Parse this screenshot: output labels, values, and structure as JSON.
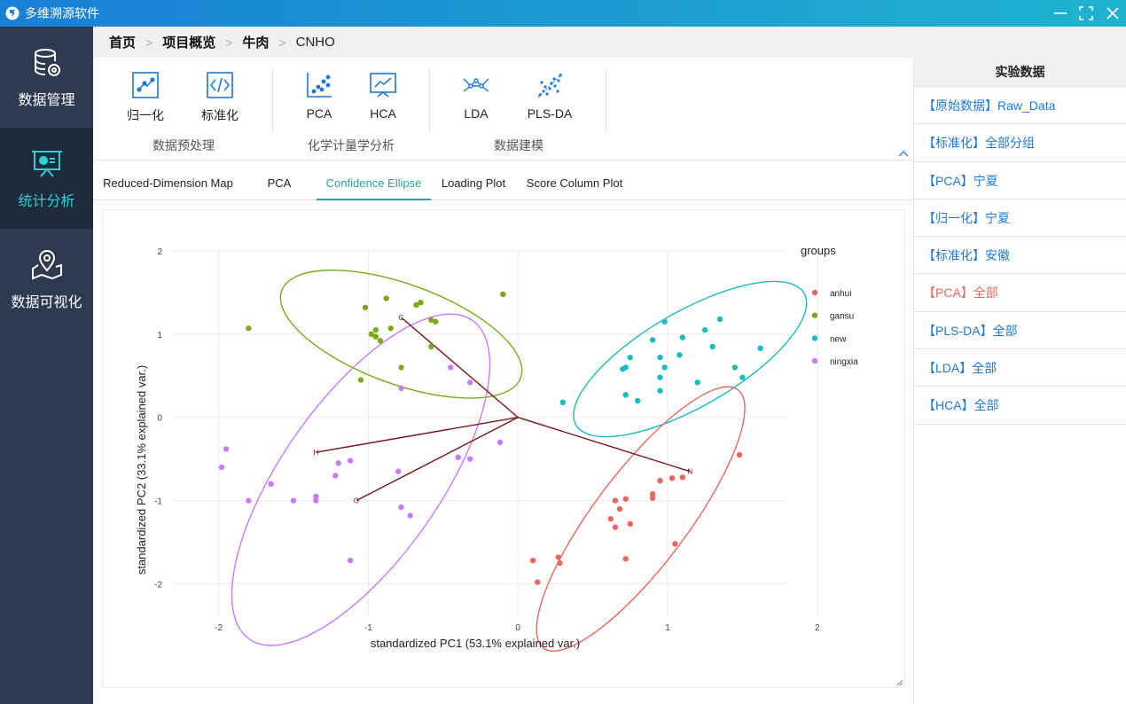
{
  "app": {
    "title": "多维溯源软件"
  },
  "sidebar": {
    "items": [
      {
        "label": "数据管理",
        "icon": "database-gear-icon",
        "active": false
      },
      {
        "label": "统计分析",
        "icon": "presentation-chart-icon",
        "active": true
      },
      {
        "label": "数据可视化",
        "icon": "map-pin-icon",
        "active": false
      }
    ]
  },
  "breadcrumb": [
    "首页",
    "项目概览",
    "牛肉",
    "CNHO"
  ],
  "toolbar": {
    "groups": [
      {
        "label": "数据预处理",
        "tools": [
          {
            "label": "归一化",
            "icon": "normalize-icon"
          },
          {
            "label": "标准化",
            "icon": "code-icon"
          }
        ]
      },
      {
        "label": "化学计量学分析",
        "tools": [
          {
            "label": "PCA",
            "icon": "scatter-icon"
          },
          {
            "label": "HCA",
            "icon": "line-chart-icon"
          }
        ]
      },
      {
        "label": "数据建模",
        "tools": [
          {
            "label": "LDA",
            "icon": "network-icon"
          },
          {
            "label": "PLS-DA",
            "icon": "dots-icon"
          }
        ]
      }
    ]
  },
  "tabs": [
    "Reduced-Dimension Map",
    "PCA",
    "Confidence Ellipse",
    "Loading Plot",
    "Score Column Plot"
  ],
  "active_tab": "Confidence Ellipse",
  "right_panel": {
    "header": "实验数据",
    "items": [
      {
        "label": "【原始数据】Raw_Data",
        "active": false
      },
      {
        "label": "【标准化】全部分组",
        "active": false
      },
      {
        "label": "【PCA】宁夏",
        "active": false
      },
      {
        "label": "【归一化】宁夏",
        "active": false
      },
      {
        "label": "【标准化】安徽",
        "active": false
      },
      {
        "label": "【PCA】全部",
        "active": true
      },
      {
        "label": "【PLS-DA】全部",
        "active": false
      },
      {
        "label": "【LDA】全部",
        "active": false
      },
      {
        "label": "【HCA】全部",
        "active": false
      }
    ]
  },
  "colors": {
    "accent": "#26a69a",
    "link": "#1f78d1",
    "active_item": "#e9675f",
    "sidebar": "#2d3a4f"
  },
  "chart_data": {
    "type": "scatter",
    "xlabel": "standardized PC1 (53.1% explained var.)",
    "ylabel": "standardized PC2 (33.1% explained var.)",
    "xlim": [
      -2.3,
      1.8
    ],
    "ylim": [
      -2.4,
      2.0
    ],
    "xticks": [
      -2,
      -1,
      0,
      1,
      2
    ],
    "yticks": [
      -2,
      -1,
      0,
      1,
      2
    ],
    "grid": true,
    "legend": {
      "title": "groups",
      "placement": "right"
    },
    "series": [
      {
        "name": "anhui",
        "color": "#e9675f",
        "points": [
          [
            0.65,
            -1.0
          ],
          [
            0.72,
            -0.98
          ],
          [
            0.9,
            -0.92
          ],
          [
            0.95,
            -0.76
          ],
          [
            1.1,
            -0.72
          ],
          [
            1.48,
            -0.45
          ],
          [
            0.68,
            -1.1
          ],
          [
            0.62,
            -1.22
          ],
          [
            0.75,
            -1.28
          ],
          [
            0.65,
            -1.32
          ],
          [
            0.9,
            -0.97
          ],
          [
            1.05,
            -1.52
          ],
          [
            0.1,
            -1.72
          ],
          [
            0.27,
            -1.68
          ],
          [
            0.28,
            -1.75
          ],
          [
            0.72,
            -1.7
          ],
          [
            0.13,
            -1.98
          ],
          [
            1.03,
            -0.73
          ]
        ]
      },
      {
        "name": "gansu",
        "color": "#7aaa19",
        "points": [
          [
            -1.8,
            1.07
          ],
          [
            -0.88,
            1.43
          ],
          [
            -0.65,
            1.38
          ],
          [
            -0.68,
            1.35
          ],
          [
            -0.58,
            1.17
          ],
          [
            -0.55,
            1.15
          ],
          [
            -1.02,
            1.32
          ],
          [
            -0.95,
            1.05
          ],
          [
            -0.95,
            0.97
          ],
          [
            -0.98,
            1.0
          ],
          [
            -0.85,
            1.07
          ],
          [
            -0.92,
            0.92
          ],
          [
            -0.58,
            0.85
          ],
          [
            -0.78,
            0.6
          ],
          [
            -1.05,
            0.45
          ],
          [
            -0.1,
            1.48
          ]
        ]
      },
      {
        "name": "new",
        "color": "#17bcbf",
        "points": [
          [
            0.98,
            1.15
          ],
          [
            1.35,
            1.18
          ],
          [
            1.25,
            1.05
          ],
          [
            1.1,
            0.96
          ],
          [
            0.9,
            0.93
          ],
          [
            1.3,
            0.85
          ],
          [
            1.62,
            0.83
          ],
          [
            1.08,
            0.75
          ],
          [
            0.95,
            0.72
          ],
          [
            0.75,
            0.72
          ],
          [
            0.72,
            0.6
          ],
          [
            0.7,
            0.58
          ],
          [
            0.98,
            0.6
          ],
          [
            1.45,
            0.6
          ],
          [
            1.5,
            0.48
          ],
          [
            0.95,
            0.48
          ],
          [
            1.2,
            0.42
          ],
          [
            0.95,
            0.32
          ],
          [
            0.72,
            0.27
          ],
          [
            0.8,
            0.2
          ],
          [
            0.3,
            0.18
          ]
        ]
      },
      {
        "name": "ningxia",
        "color": "#c77cff",
        "points": [
          [
            -0.45,
            0.6
          ],
          [
            -0.32,
            0.42
          ],
          [
            -0.78,
            0.35
          ],
          [
            -1.95,
            -0.38
          ],
          [
            -1.98,
            -0.6
          ],
          [
            -1.2,
            -0.55
          ],
          [
            -1.12,
            -0.52
          ],
          [
            -1.22,
            -0.7
          ],
          [
            -1.65,
            -0.8
          ],
          [
            -0.8,
            -0.65
          ],
          [
            -0.4,
            -0.48
          ],
          [
            -0.32,
            -0.5
          ],
          [
            -0.12,
            -0.3
          ],
          [
            -1.35,
            -0.95
          ],
          [
            -1.35,
            -1.0
          ],
          [
            -1.5,
            -1.0
          ],
          [
            -1.8,
            -1.0
          ],
          [
            -0.78,
            -1.08
          ],
          [
            -0.72,
            -1.18
          ],
          [
            -1.12,
            -1.72
          ]
        ]
      }
    ],
    "ellipses": [
      {
        "group": "gansu",
        "cx": -0.78,
        "cy": 1.0,
        "rx": 0.85,
        "ry": 0.6,
        "angle_deg": 20
      },
      {
        "group": "new",
        "cx": 1.15,
        "cy": 0.7,
        "rx": 0.88,
        "ry": 0.57,
        "angle_deg": -30
      },
      {
        "group": "ningxia",
        "cx": -1.05,
        "cy": -0.75,
        "rx": 1.3,
        "ry": 0.95,
        "angle_deg": -55
      },
      {
        "group": "anhui",
        "cx": 0.82,
        "cy": -1.22,
        "rx": 1.08,
        "ry": 0.56,
        "angle_deg": -53
      }
    ],
    "arrows": [
      {
        "label": "C",
        "x": -0.78,
        "y": 1.2
      },
      {
        "label": "N",
        "x": 1.15,
        "y": -0.65
      },
      {
        "label": "H",
        "x": -1.35,
        "y": -0.42
      },
      {
        "label": "O",
        "x": -1.08,
        "y": -1.0
      }
    ]
  }
}
